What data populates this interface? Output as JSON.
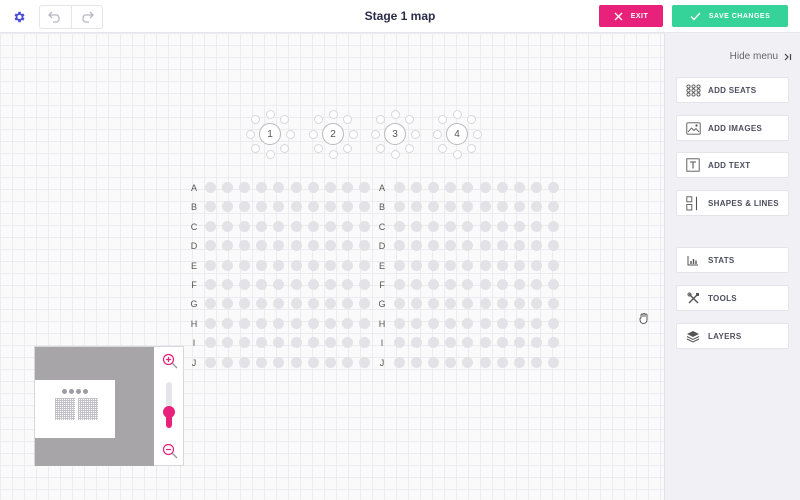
{
  "header": {
    "title": "Stage 1 map",
    "exit_label": "EXIT",
    "save_label": "SAVE CHANGES"
  },
  "colors": {
    "accent": "#e8217a",
    "save": "#35d29a",
    "gear": "#4b4fd6"
  },
  "icons": {
    "settings": "gear-icon",
    "undo": "undo-icon",
    "redo": "redo-icon",
    "exit": "close-icon",
    "save": "check-icon",
    "zoom_in": "zoom-in-icon",
    "zoom_out": "zoom-out-icon",
    "hide_menu": "collapse-right-icon"
  },
  "tables": [
    {
      "label": "1"
    },
    {
      "label": "2"
    },
    {
      "label": "3"
    },
    {
      "label": "4"
    }
  ],
  "rows": [
    "A",
    "B",
    "C",
    "D",
    "E",
    "F",
    "G",
    "H",
    "I",
    "J"
  ],
  "zoom": {
    "level": 0.35
  },
  "panel": {
    "hide_menu": "Hide menu",
    "tools": [
      {
        "label": "ADD SEATS",
        "icon": "seats-grid-icon"
      },
      {
        "label": "ADD IMAGES",
        "icon": "image-icon"
      },
      {
        "label": "ADD TEXT",
        "icon": "text-icon"
      },
      {
        "label": "SHAPES & LINES",
        "icon": "shapes-lines-icon"
      },
      {
        "label": "STATS",
        "icon": "bar-chart-icon"
      },
      {
        "label": "TOOLS",
        "icon": "tools-icon"
      },
      {
        "label": "LAYERS",
        "icon": "layers-icon"
      }
    ]
  }
}
